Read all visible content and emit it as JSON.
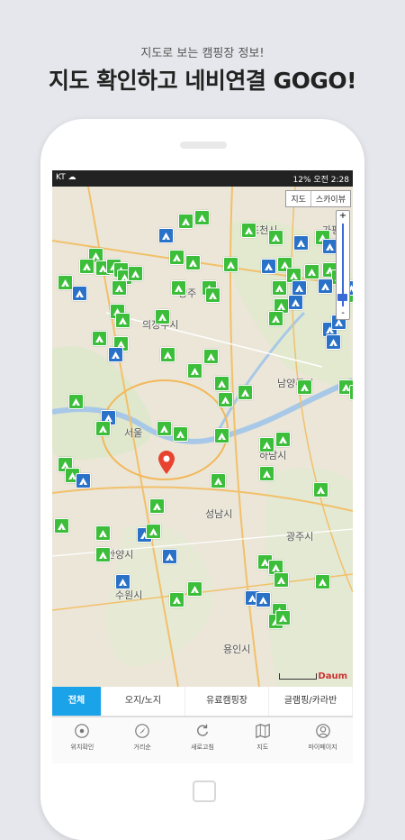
{
  "promo": {
    "subtitle": "지도로 보는 캠핑장 정보!",
    "title": "지도 확인하고 네비연결 GOGO!"
  },
  "status_bar": {
    "left": "KT ☁",
    "right": "12% 오전 2:28"
  },
  "map": {
    "toggle": [
      "지도",
      "스카이뷰"
    ],
    "zoom": {
      "plus": "+",
      "minus": "-"
    },
    "logo": "Daum",
    "cities": [
      {
        "name": "포천시"
      },
      {
        "name": "양주"
      },
      {
        "name": "의정부시"
      },
      {
        "name": "서울"
      },
      {
        "name": "하남시"
      },
      {
        "name": "성남시"
      },
      {
        "name": "광주시"
      },
      {
        "name": "안양시"
      },
      {
        "name": "수원시"
      },
      {
        "name": "용인시"
      },
      {
        "name": "남양주시"
      },
      {
        "name": "가평"
      }
    ]
  },
  "filter_tabs": [
    {
      "label": "전체",
      "active": true
    },
    {
      "label": "오지/노지",
      "active": false
    },
    {
      "label": "유료캠핑장",
      "active": false
    },
    {
      "label": "글램핑/카라반",
      "active": false
    }
  ],
  "bottom_nav": [
    {
      "label": "위치확인",
      "icon": "location-icon"
    },
    {
      "label": "거리순",
      "icon": "compass-icon"
    },
    {
      "label": "새로고침",
      "icon": "refresh-icon"
    },
    {
      "label": "지도",
      "icon": "map-icon"
    },
    {
      "label": "마이페이지",
      "icon": "user-icon"
    }
  ],
  "colors": {
    "accent": "#1aa3e8",
    "marker_green": "#3cbe3a",
    "marker_blue": "#2a72c8",
    "pin_red": "#e8432e"
  }
}
